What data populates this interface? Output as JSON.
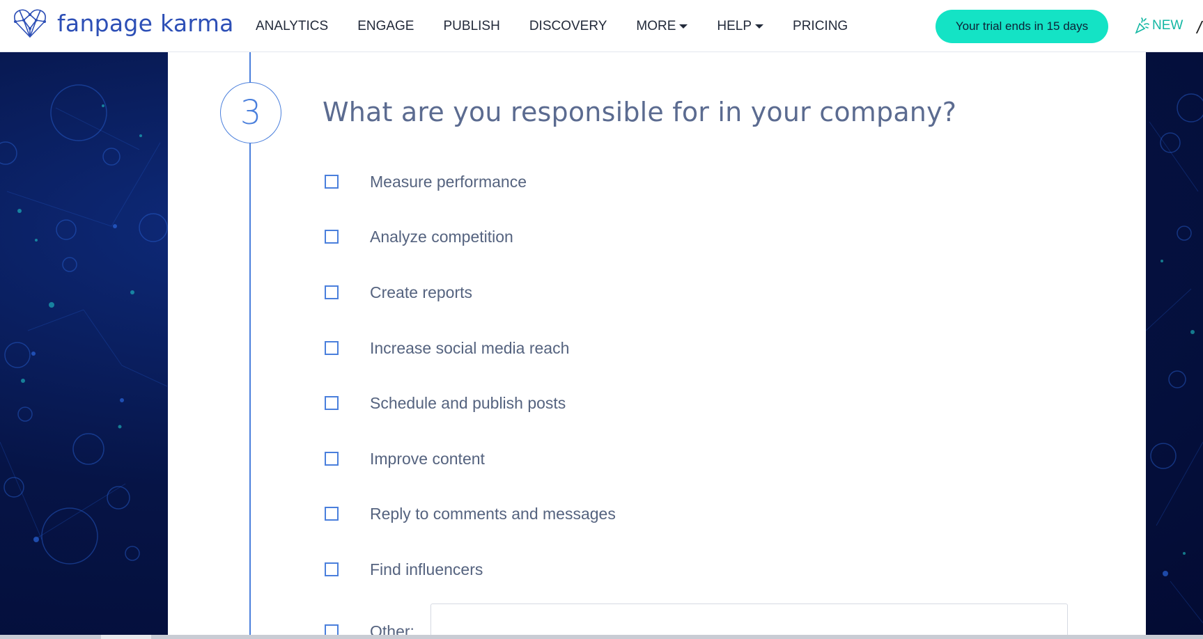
{
  "brand": {
    "name": "fanpage karma"
  },
  "nav": {
    "items": [
      {
        "label": "ANALYTICS",
        "dropdown": false
      },
      {
        "label": "ENGAGE",
        "dropdown": false
      },
      {
        "label": "PUBLISH",
        "dropdown": false
      },
      {
        "label": "DISCOVERY",
        "dropdown": false
      },
      {
        "label": "MORE",
        "dropdown": true
      },
      {
        "label": "HELP",
        "dropdown": true
      },
      {
        "label": "PRICING",
        "dropdown": false
      }
    ],
    "trial_button": "Your trial ends in 15 days",
    "new_label": "NEW"
  },
  "step": {
    "number": "3",
    "question": "What are you responsible for in your company?",
    "options": [
      {
        "label": "Measure performance",
        "checked": false
      },
      {
        "label": "Analyze competition",
        "checked": false
      },
      {
        "label": "Create reports",
        "checked": false
      },
      {
        "label": "Increase social media reach",
        "checked": false
      },
      {
        "label": "Schedule and publish posts",
        "checked": false
      },
      {
        "label": "Improve content",
        "checked": false
      },
      {
        "label": "Reply to comments and messages",
        "checked": false
      },
      {
        "label": "Find influencers",
        "checked": false
      }
    ],
    "other": {
      "label": "Other:",
      "value": "",
      "checked": false
    }
  },
  "colors": {
    "accent": "#4a7fdc",
    "brand": "#2d4fb6",
    "trial_button": "#14e3c5",
    "new_badge": "#13b7a3",
    "background": "#07124a"
  },
  "icons": {
    "logo": "heart-network-logo-icon",
    "new": "party-popper-icon",
    "checkbox": "checkbox-unchecked-icon"
  }
}
